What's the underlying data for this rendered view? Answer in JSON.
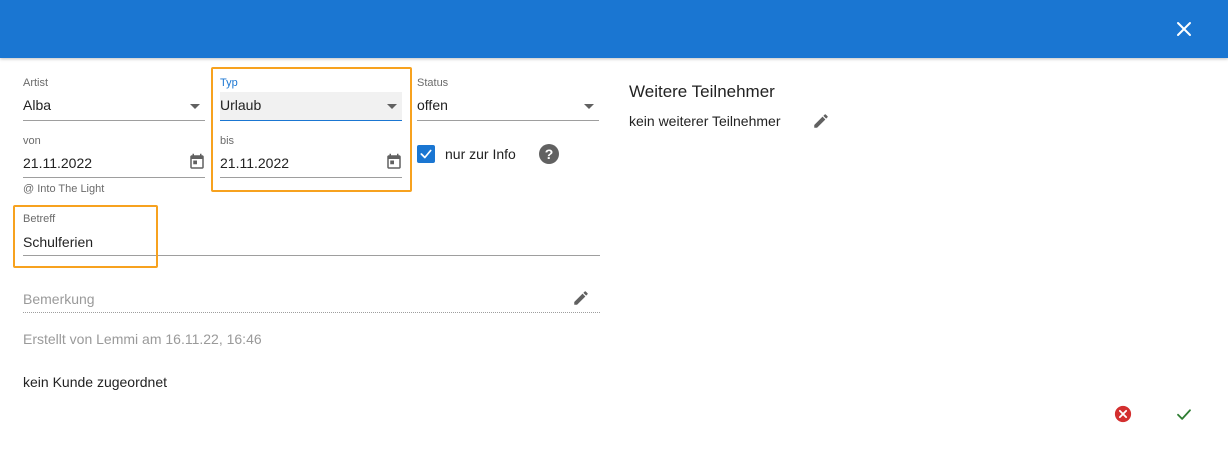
{
  "form": {
    "artist": {
      "label": "Artist",
      "value": "Alba"
    },
    "typ": {
      "label": "Typ",
      "value": "Urlaub"
    },
    "status": {
      "label": "Status",
      "value": "offen"
    },
    "von": {
      "label": "von",
      "value": "21.11.2022",
      "hint": "@ Into The Light"
    },
    "bis": {
      "label": "bis",
      "value": "21.11.2022"
    },
    "info_checkbox": {
      "label": "nur zur Info",
      "checked": true
    },
    "betreff": {
      "label": "Betreff",
      "value": "Schulferien"
    },
    "bemerkung": {
      "placeholder": "Bemerkung"
    },
    "created_text": "Erstellt von Lemmi am 16.11.22, 16:46",
    "customer_text": "kein Kunde zugeordnet"
  },
  "participants": {
    "title": "Weitere Teilnehmer",
    "empty_text": "kein weiterer Teilnehmer"
  },
  "colors": {
    "header": "#1a76d2",
    "highlight": "#f7a21f",
    "cancel": "#d32f2f",
    "confirm": "#2e7d32"
  }
}
